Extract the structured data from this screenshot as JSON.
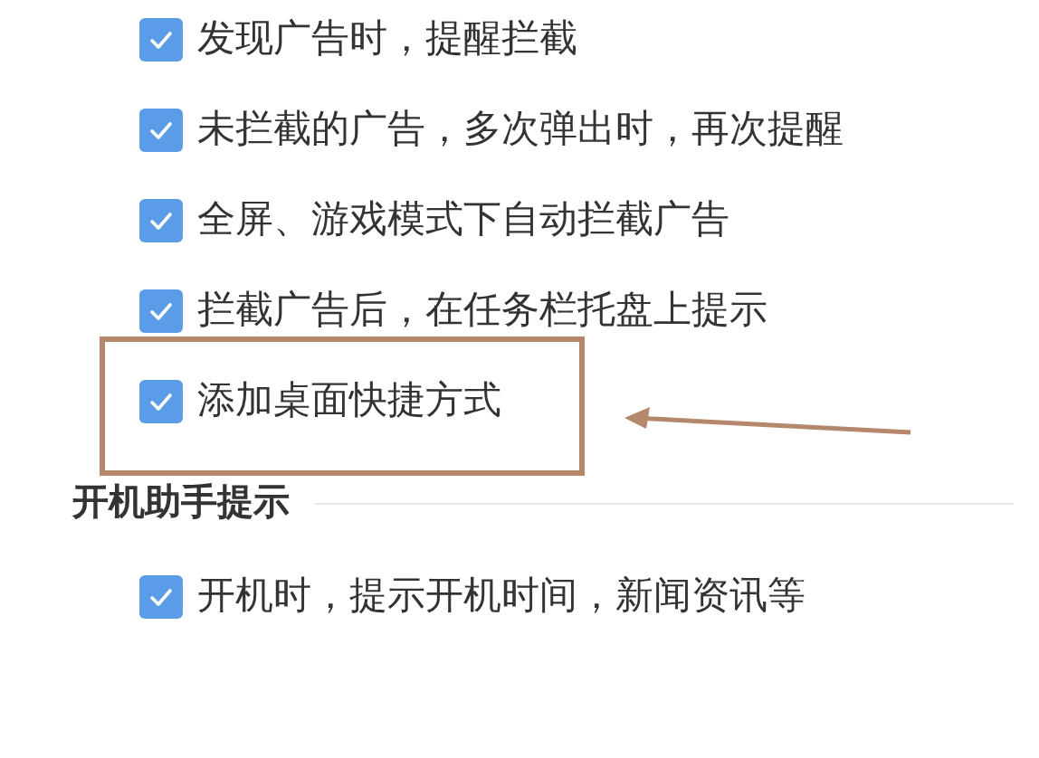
{
  "options": [
    {
      "label": "发现广告时，提醒拦截",
      "checked": true
    },
    {
      "label": "未拦截的广告，多次弹出时，再次提醒",
      "checked": true
    },
    {
      "label": "全屏、游戏模式下自动拦截广告",
      "checked": true
    },
    {
      "label": "拦截广告后，在任务栏托盘上提示",
      "checked": true
    },
    {
      "label": "添加桌面快捷方式",
      "checked": true
    }
  ],
  "startup_section": {
    "title": "开机助手提示",
    "options": [
      {
        "label": "开机时，提示开机时间，新闻资讯等",
        "checked": true
      }
    ]
  }
}
